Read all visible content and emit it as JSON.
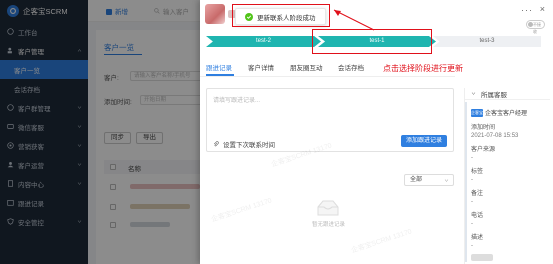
{
  "sidebar": {
    "brand": "企客宝SCRM",
    "items": [
      {
        "label": "工作台"
      },
      {
        "label": "客户管理"
      },
      {
        "label": "客户一览",
        "active": true
      },
      {
        "label": "会话存档"
      },
      {
        "label": "客户群管理"
      },
      {
        "label": "微信客服"
      },
      {
        "label": "营销获客"
      },
      {
        "label": "客户运营"
      },
      {
        "label": "内容中心"
      },
      {
        "label": "跟进记录"
      },
      {
        "label": "安全管控"
      }
    ]
  },
  "topbar": {
    "tab_new": "新增",
    "search_placeholder": "输入客户"
  },
  "main": {
    "title": "客户一览",
    "customer_label": "客户:",
    "customer_placeholder": "请输入客户名称/手机号",
    "add_time_label": "添加时间:",
    "add_time_placeholder": "开始日期",
    "sync_btn": "同步",
    "export_btn": "导出",
    "col_name": "名称"
  },
  "drawer": {
    "toast": "更新联系人阶段成功",
    "stages": [
      "test-2",
      "test-1",
      "test-3"
    ],
    "tabs": [
      "跟进记录",
      "客户详情",
      "朋友圈互动",
      "会话存档"
    ],
    "annotation": "点击选择阶段进行更新",
    "note_placeholder": "请填写跟进记录...",
    "remind_label": "设置下次联系时间",
    "add_note_btn": "添加跟进记录",
    "filter_value": "全部",
    "empty_text": "暂无跟进记录",
    "toggle_label": "不接收",
    "watermark": "企客宝SCRM 13170"
  },
  "info": {
    "header": "所属客服",
    "owner_tag": "企客宝",
    "owner_name": "企客宝客户经理",
    "added_label": "添加时间",
    "added_value": "2021-07-08 15:53",
    "source_label": "客户来源",
    "source_value": "-",
    "tags_label": "标签",
    "tags_value": "-",
    "remark_label": "备注",
    "remark_value": "-",
    "phone_label": "电话",
    "phone_value": "-",
    "desc_label": "描述",
    "desc_value": "-"
  },
  "colors": {
    "accent": "#2f7fe0",
    "stage_active": "#1fb5b0",
    "annotation": "#e0101a",
    "success": "#52c41a"
  }
}
